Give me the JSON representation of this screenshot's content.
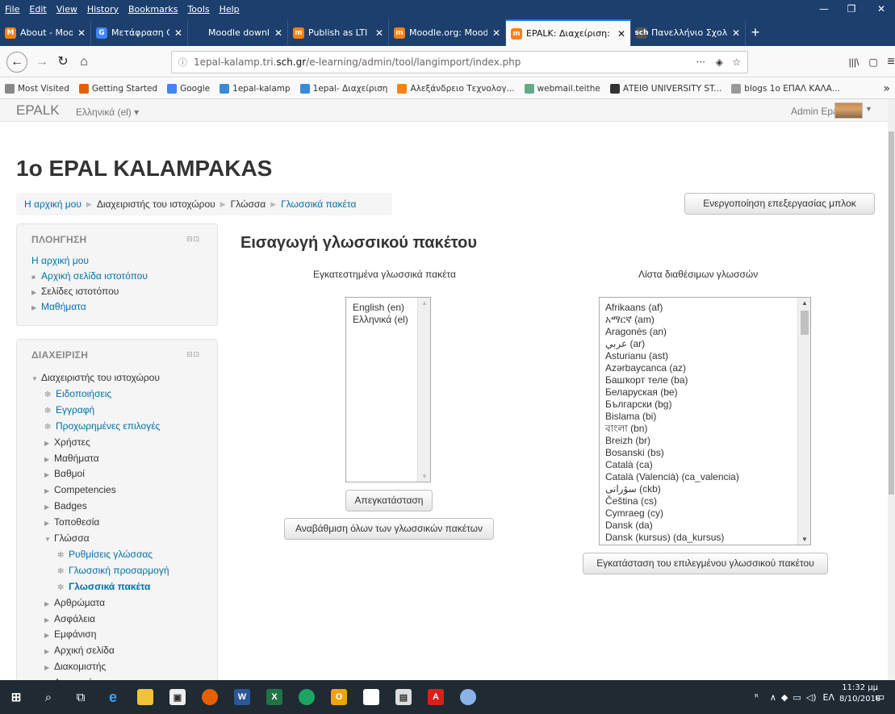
{
  "browser": {
    "menu": [
      "File",
      "Edit",
      "View",
      "History",
      "Bookmarks",
      "Tools",
      "Help"
    ],
    "tabs": [
      {
        "title": "About - Moodle",
        "color": "#f98012",
        "icon": "M"
      },
      {
        "title": "Μετάφραση Google",
        "color": "#4285f4",
        "icon": "G"
      },
      {
        "title": "Moodle downloads",
        "color": "#1c3f6e",
        "icon": ""
      },
      {
        "title": "Publish as LTI tool - M",
        "color": "#f98012",
        "icon": "m"
      },
      {
        "title": "Moodle.org: Moodle S",
        "color": "#f98012",
        "icon": "m"
      },
      {
        "title": "EPALK: Διαχείριση: Γλώ",
        "color": "#f98012",
        "icon": "m"
      },
      {
        "title": "Πανελλήνιο Σχολικό Δ",
        "color": "#555",
        "icon": "sch"
      }
    ],
    "url_prefix": "1epal-kalamp.tri.",
    "url_domain": "sch.gr",
    "url_path": "/e-learning/admin/tool/langimport/index.php",
    "url_more": "···",
    "bookmarks": [
      {
        "label": "Most Visited",
        "color": "#888"
      },
      {
        "label": "Getting Started",
        "color": "#e66000"
      },
      {
        "label": "Google",
        "color": "#4285f4"
      },
      {
        "label": "1epal-kalamp",
        "color": "#3a8ad6"
      },
      {
        "label": "1epal- Διαχείριση",
        "color": "#3a8ad6"
      },
      {
        "label": "Αλεξάνδρειο Τεχνολογ...",
        "color": "#f98012"
      },
      {
        "label": "webmail.teithe",
        "color": "#6a8"
      },
      {
        "label": "ΑΤΕΙΘ UNIVERSITY ST...",
        "color": "#333"
      },
      {
        "label": "blogs 1ο ΕΠΑΛ ΚΑΛΑ...",
        "color": "#999"
      }
    ]
  },
  "moodle": {
    "brand": "EPALK",
    "language": "Ελληνικά (el) ▾",
    "user": "Admin Epal",
    "site_title": "1o EPAL KALAMPAKAS",
    "breadcrumb": [
      "Η αρχική μου",
      "Διαχειριστής του ιστοχώρου",
      "Γλώσσα",
      "Γλωσσικά πακέτα"
    ],
    "edit_blocks_button": "Ενεργοποίηση επεξεργασίας μπλοκ",
    "nav_block": {
      "title": "ΠΛΟΗΓΗΣΗ",
      "items": [
        {
          "label": "Η αρχική μου",
          "marker": "",
          "link": true
        },
        {
          "label": "Αρχική σελίδα ιστοτόπου",
          "marker": "■",
          "link": true
        },
        {
          "label": "Σελίδες ιστοτόπου",
          "marker": "▶",
          "link": false
        },
        {
          "label": "Μαθήματα",
          "marker": "▶",
          "link": true
        }
      ]
    },
    "admin_block": {
      "title": "ΔΙΑΧΕΙΡΙΣΗ",
      "items": [
        {
          "label": "Διαχειριστής του ιστοχώρου",
          "marker": "▼",
          "indent": 0,
          "link": false
        },
        {
          "label": "Ειδοποιήσεις",
          "marker": "✻",
          "indent": 1,
          "link": true
        },
        {
          "label": "Εγγραφή",
          "marker": "✻",
          "indent": 1,
          "link": true
        },
        {
          "label": "Προχωρημένες επιλογές",
          "marker": "✻",
          "indent": 1,
          "link": true
        },
        {
          "label": "Χρήστες",
          "marker": "▶",
          "indent": 1,
          "link": false
        },
        {
          "label": "Μαθήματα",
          "marker": "▶",
          "indent": 1,
          "link": false
        },
        {
          "label": "Βαθμοί",
          "marker": "▶",
          "indent": 1,
          "link": false
        },
        {
          "label": "Competencies",
          "marker": "▶",
          "indent": 1,
          "link": false
        },
        {
          "label": "Badges",
          "marker": "▶",
          "indent": 1,
          "link": false
        },
        {
          "label": "Τοποθεσία",
          "marker": "▶",
          "indent": 1,
          "link": false
        },
        {
          "label": "Γλώσσα",
          "marker": "▼",
          "indent": 1,
          "link": false
        },
        {
          "label": "Ρυθμίσεις γλώσσας",
          "marker": "✻",
          "indent": 2,
          "link": true
        },
        {
          "label": "Γλωσσική προσαρμογή",
          "marker": "✻",
          "indent": 2,
          "link": true
        },
        {
          "label": "Γλωσσικά πακέτα",
          "marker": "✻",
          "indent": 2,
          "link": true,
          "active": true
        },
        {
          "label": "Αρθρώματα",
          "marker": "▶",
          "indent": 1,
          "link": false
        },
        {
          "label": "Ασφάλεια",
          "marker": "▶",
          "indent": 1,
          "link": false
        },
        {
          "label": "Εμφάνιση",
          "marker": "▶",
          "indent": 1,
          "link": false
        },
        {
          "label": "Αρχική σελίδα",
          "marker": "▶",
          "indent": 1,
          "link": false
        },
        {
          "label": "Διακομιστής",
          "marker": "▶",
          "indent": 1,
          "link": false
        },
        {
          "label": "Αναφορές",
          "marker": "▶",
          "indent": 1,
          "link": false
        }
      ]
    },
    "page_heading": "Εισαγωγή γλωσσικού πακέτου",
    "installed_heading": "Εγκατεστημένα γλωσσικά πακέτα",
    "installed_packs": [
      "English (en)",
      "Ελληνικά (el)"
    ],
    "uninstall_button": "Απεγκατάσταση",
    "update_all_button": "Αναβάθμιση όλων των γλωσσικών πακέτων",
    "available_heading": "Λίστα διαθέσιμων γλωσσών",
    "available_packs": [
      "Afrikaans (af)",
      "አማርኛ (am)",
      "Aragonés (an)",
      "عربي (ar)",
      "Asturianu (ast)",
      "Azərbaycanca (az)",
      "Башҡорт теле (ba)",
      "Беларуская (be)",
      "Български (bg)",
      "Bislama (bi)",
      "বাংলা (bn)",
      "Breizh (br)",
      "Bosanski (bs)",
      "Català (ca)",
      "Català (Valencià) (ca_valencia)",
      "سۆرانی (ckb)",
      "Čeština (cs)",
      "Cymraeg (cy)",
      "Dansk (da)",
      "Dansk (kursus) (da_kursus)"
    ],
    "install_button": "Εγκατάσταση του επιλεγμένου γλωσσικού πακέτου"
  },
  "taskbar": {
    "lang": "ΕΛ",
    "time": "11:32 μμ",
    "date": "8/10/2018"
  }
}
